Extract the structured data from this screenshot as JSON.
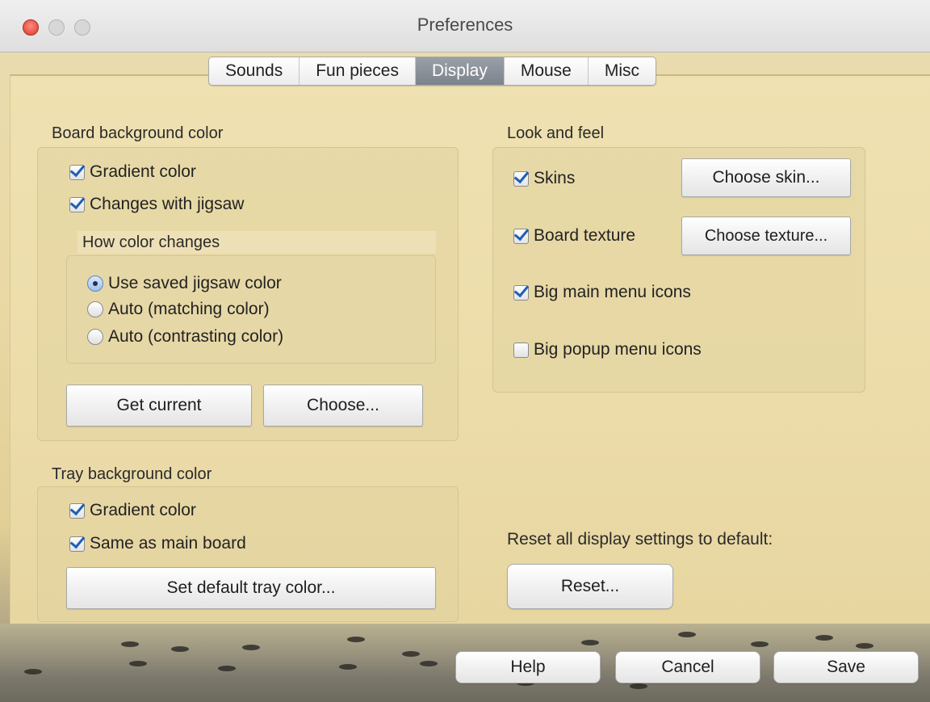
{
  "window": {
    "title": "Preferences"
  },
  "tabs": [
    {
      "label": "Sounds"
    },
    {
      "label": "Fun pieces"
    },
    {
      "label": "Display",
      "active": true
    },
    {
      "label": "Mouse"
    },
    {
      "label": "Misc"
    }
  ],
  "board_bg": {
    "title": "Board background color",
    "gradient": {
      "label": "Gradient color",
      "checked": true
    },
    "changes_with_jigsaw": {
      "label": "Changes with jigsaw",
      "checked": true
    },
    "how_color_changes": {
      "title": "How color changes",
      "options": [
        {
          "label": "Use saved jigsaw color",
          "selected": true
        },
        {
          "label": "Auto (matching color)",
          "selected": false
        },
        {
          "label": "Auto (contrasting color)",
          "selected": false
        }
      ]
    },
    "get_current_label": "Get current",
    "choose_label": "Choose..."
  },
  "tray_bg": {
    "title": "Tray background color",
    "gradient": {
      "label": "Gradient color",
      "checked": true
    },
    "same_as_main": {
      "label": "Same as main board",
      "checked": true
    },
    "set_default_label": "Set default tray color..."
  },
  "look_and_feel": {
    "title": "Look and feel",
    "skins": {
      "label": "Skins",
      "checked": true
    },
    "choose_skin_label": "Choose skin...",
    "board_texture": {
      "label": "Board texture",
      "checked": true
    },
    "choose_texture_label": "Choose texture...",
    "big_main_menu_icons": {
      "label": "Big main menu icons",
      "checked": true
    },
    "big_popup_menu_icons": {
      "label": "Big popup menu icons",
      "checked": false
    }
  },
  "reset": {
    "text": "Reset all display settings to default:",
    "button_label": "Reset..."
  },
  "footer": {
    "help_label": "Help",
    "cancel_label": "Cancel",
    "save_label": "Save"
  },
  "colors": {
    "accent": "#1f5fb5",
    "active_tab": "#8a9098",
    "panel": "#ecdcaa"
  }
}
